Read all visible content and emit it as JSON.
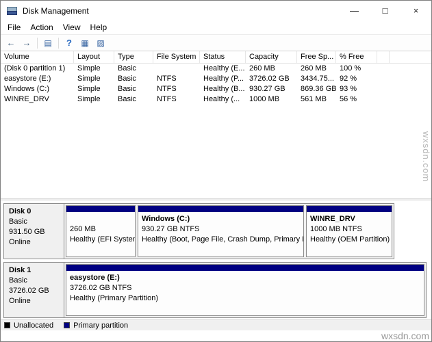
{
  "window": {
    "title": "Disk Management",
    "controls": {
      "minimize": "—",
      "maximize": "□",
      "close": "×"
    }
  },
  "menu": {
    "items": [
      {
        "label": "File"
      },
      {
        "label": "Action"
      },
      {
        "label": "View"
      },
      {
        "label": "Help"
      }
    ]
  },
  "toolbar": {
    "icons": [
      {
        "name": "back",
        "glyph": "←"
      },
      {
        "name": "forward",
        "glyph": "→"
      },
      {
        "name": "console-tree",
        "glyph": "▤"
      },
      {
        "name": "help",
        "glyph": "?"
      },
      {
        "name": "disk-list-view",
        "glyph": "▦"
      },
      {
        "name": "graphical-view",
        "glyph": "▨"
      }
    ]
  },
  "volume_list": {
    "columns": [
      "Volume",
      "Layout",
      "Type",
      "File System",
      "Status",
      "Capacity",
      "Free Sp...",
      "% Free"
    ],
    "rows": [
      [
        "(Disk 0 partition 1)",
        "Simple",
        "Basic",
        "",
        "Healthy (E...",
        "260 MB",
        "260 MB",
        "100 %"
      ],
      [
        "easystore (E:)",
        "Simple",
        "Basic",
        "NTFS",
        "Healthy (P...",
        "3726.02 GB",
        "3434.75...",
        "92 %"
      ],
      [
        "Windows (C:)",
        "Simple",
        "Basic",
        "NTFS",
        "Healthy (B...",
        "930.27 GB",
        "869.36 GB",
        "93 %"
      ],
      [
        "WINRE_DRV",
        "Simple",
        "Basic",
        "NTFS",
        "Healthy (...",
        "1000 MB",
        "561 MB",
        "56 %"
      ]
    ]
  },
  "disks": [
    {
      "name": "Disk 0",
      "type": "Basic",
      "size": "931.50 GB",
      "status": "Online",
      "partitions": [
        {
          "title": "",
          "line1": "260 MB",
          "line2": "Healthy (EFI System"
        },
        {
          "title": "Windows  (C:)",
          "line1": "930.27 GB NTFS",
          "line2": "Healthy (Boot, Page File, Crash Dump, Primary Partiti"
        },
        {
          "title": "WINRE_DRV",
          "line1": "1000 MB NTFS",
          "line2": "Healthy (OEM Partition)"
        }
      ]
    },
    {
      "name": "Disk 1",
      "type": "Basic",
      "size": "3726.02 GB",
      "status": "Online",
      "partitions": [
        {
          "title": "easystore  (E:)",
          "line1": "3726.02 GB NTFS",
          "line2": "Healthy (Primary Partition)"
        }
      ]
    }
  ],
  "legend": {
    "items": [
      {
        "label": "Unallocated",
        "color": "#000000"
      },
      {
        "label": "Primary partition",
        "color": "#000082"
      }
    ]
  },
  "colors": {
    "partition_bar": "#000082",
    "window_border": "#7f7f7f"
  },
  "watermark": {
    "side": "wxsdn.com",
    "bottom": "wxsdn.com"
  }
}
